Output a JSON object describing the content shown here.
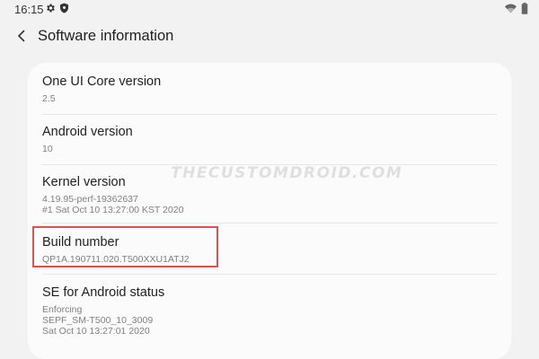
{
  "status_bar": {
    "time": "16:15",
    "icons": [
      "gear-icon",
      "shield-icon",
      "wifi-icon",
      "battery-icon"
    ]
  },
  "app_bar": {
    "title": "Software information",
    "back_icon": "chevron-left-icon"
  },
  "rows": [
    {
      "title": "One UI Core version",
      "sub": [
        "2.5"
      ]
    },
    {
      "title": "Android version",
      "sub": [
        "10"
      ]
    },
    {
      "title": "Kernel version",
      "sub": [
        "4.19.95-perf-19362637",
        "#1 Sat Oct 10 13:27:00 KST 2020"
      ]
    },
    {
      "title": "Build number",
      "sub": [
        "QP1A.190711.020.T500XXU1ATJ2"
      ]
    },
    {
      "title": "SE for Android status",
      "sub": [
        "Enforcing",
        "SEPF_SM-T500_10_3009",
        "Sat Oct 10 13:27:01 2020"
      ]
    }
  ],
  "watermark": "TheCustomDroid.com",
  "colors": {
    "background": "#f2f2f2",
    "card": "#fbfbfb",
    "highlight": "#d9534f",
    "primary_text": "#1f1f1f",
    "secondary_text": "#808080"
  }
}
